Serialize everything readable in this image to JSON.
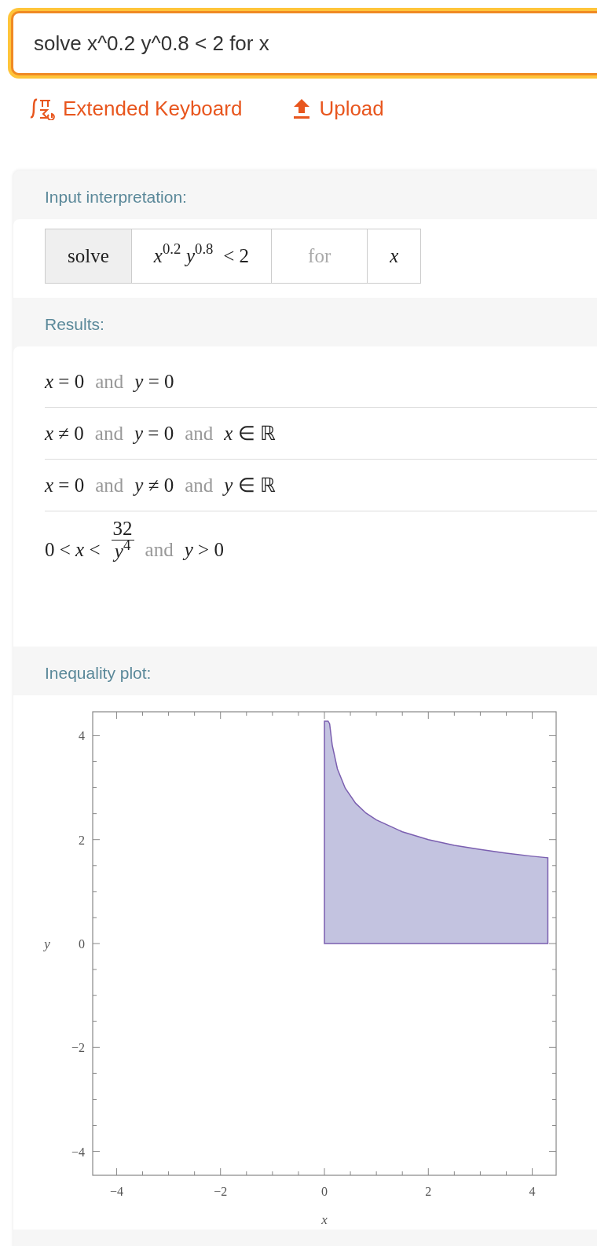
{
  "search": {
    "value": "solve x^0.2 y^0.8 < 2 for x"
  },
  "links": [
    {
      "label": "Extended Keyboard",
      "kind": "keyboard"
    },
    {
      "label": "Upload",
      "kind": "upload"
    }
  ],
  "pods": [
    {
      "kind": "interpretation",
      "title": "Input interpretation:",
      "cells": [
        {
          "kind": "command",
          "text": "solve"
        },
        {
          "kind": "math",
          "text": "*x*$^{0.2}$ *y*$^{0.8}$ < 2"
        },
        {
          "kind": "word",
          "text": "for"
        },
        {
          "kind": "math",
          "text": "*x*"
        }
      ]
    },
    {
      "kind": "results",
      "title": "Results:",
      "rows": [
        [
          {
            "kind": "math",
            "text": "*x* = 0"
          },
          {
            "kind": "word",
            "text": "and"
          },
          {
            "kind": "math",
            "text": "*y* = 0"
          }
        ],
        [
          {
            "kind": "math",
            "text": "*x* ≠ 0"
          },
          {
            "kind": "word",
            "text": "and"
          },
          {
            "kind": "math",
            "text": "*y* = 0"
          },
          {
            "kind": "word",
            "text": "and"
          },
          {
            "kind": "math",
            "text": "*x* ∈ ℝ"
          }
        ],
        [
          {
            "kind": "math",
            "text": "*x* = 0"
          },
          {
            "kind": "word",
            "text": "and"
          },
          {
            "kind": "math",
            "text": "*y* ≠ 0"
          },
          {
            "kind": "word",
            "text": "and"
          },
          {
            "kind": "math",
            "text": "*y* ∈ ℝ"
          }
        ],
        [
          {
            "kind": "math",
            "text": "0 < *x* <"
          },
          {
            "kind": "fraction",
            "numerator": "32",
            "denominator": "*y*$^{4}$"
          },
          {
            "kind": "word",
            "text": "and"
          },
          {
            "kind": "math",
            "text": "*y* > 0"
          }
        ]
      ]
    },
    {
      "kind": "plot",
      "title": "Inequality plot:",
      "chart_data": {
        "type": "area",
        "xlabel": "x",
        "ylabel": "y",
        "xlim": [
          -4.46,
          4.46
        ],
        "ylim": [
          -4.46,
          4.46
        ],
        "xticks": [
          -4,
          -2,
          0,
          2,
          4
        ],
        "yticks": [
          -4,
          -2,
          0,
          2,
          4
        ],
        "series": [
          {
            "color": "#7b5fb0",
            "x": [
              0,
              0.07,
              0.1,
              0.15,
              0.25,
              0.4,
              0.6,
              0.8,
              1,
              1.5,
              2,
              2.5,
              3,
              3.5,
              4,
              4.3
            ],
            "values": [
              4.28,
              4.28,
              4.23,
              3.82,
              3.36,
              2.99,
              2.7,
              2.51,
              2.38,
              2.15,
              2,
              1.89,
              1.81,
              1.74,
              1.68,
              1.65
            ]
          }
        ]
      }
    }
  ]
}
